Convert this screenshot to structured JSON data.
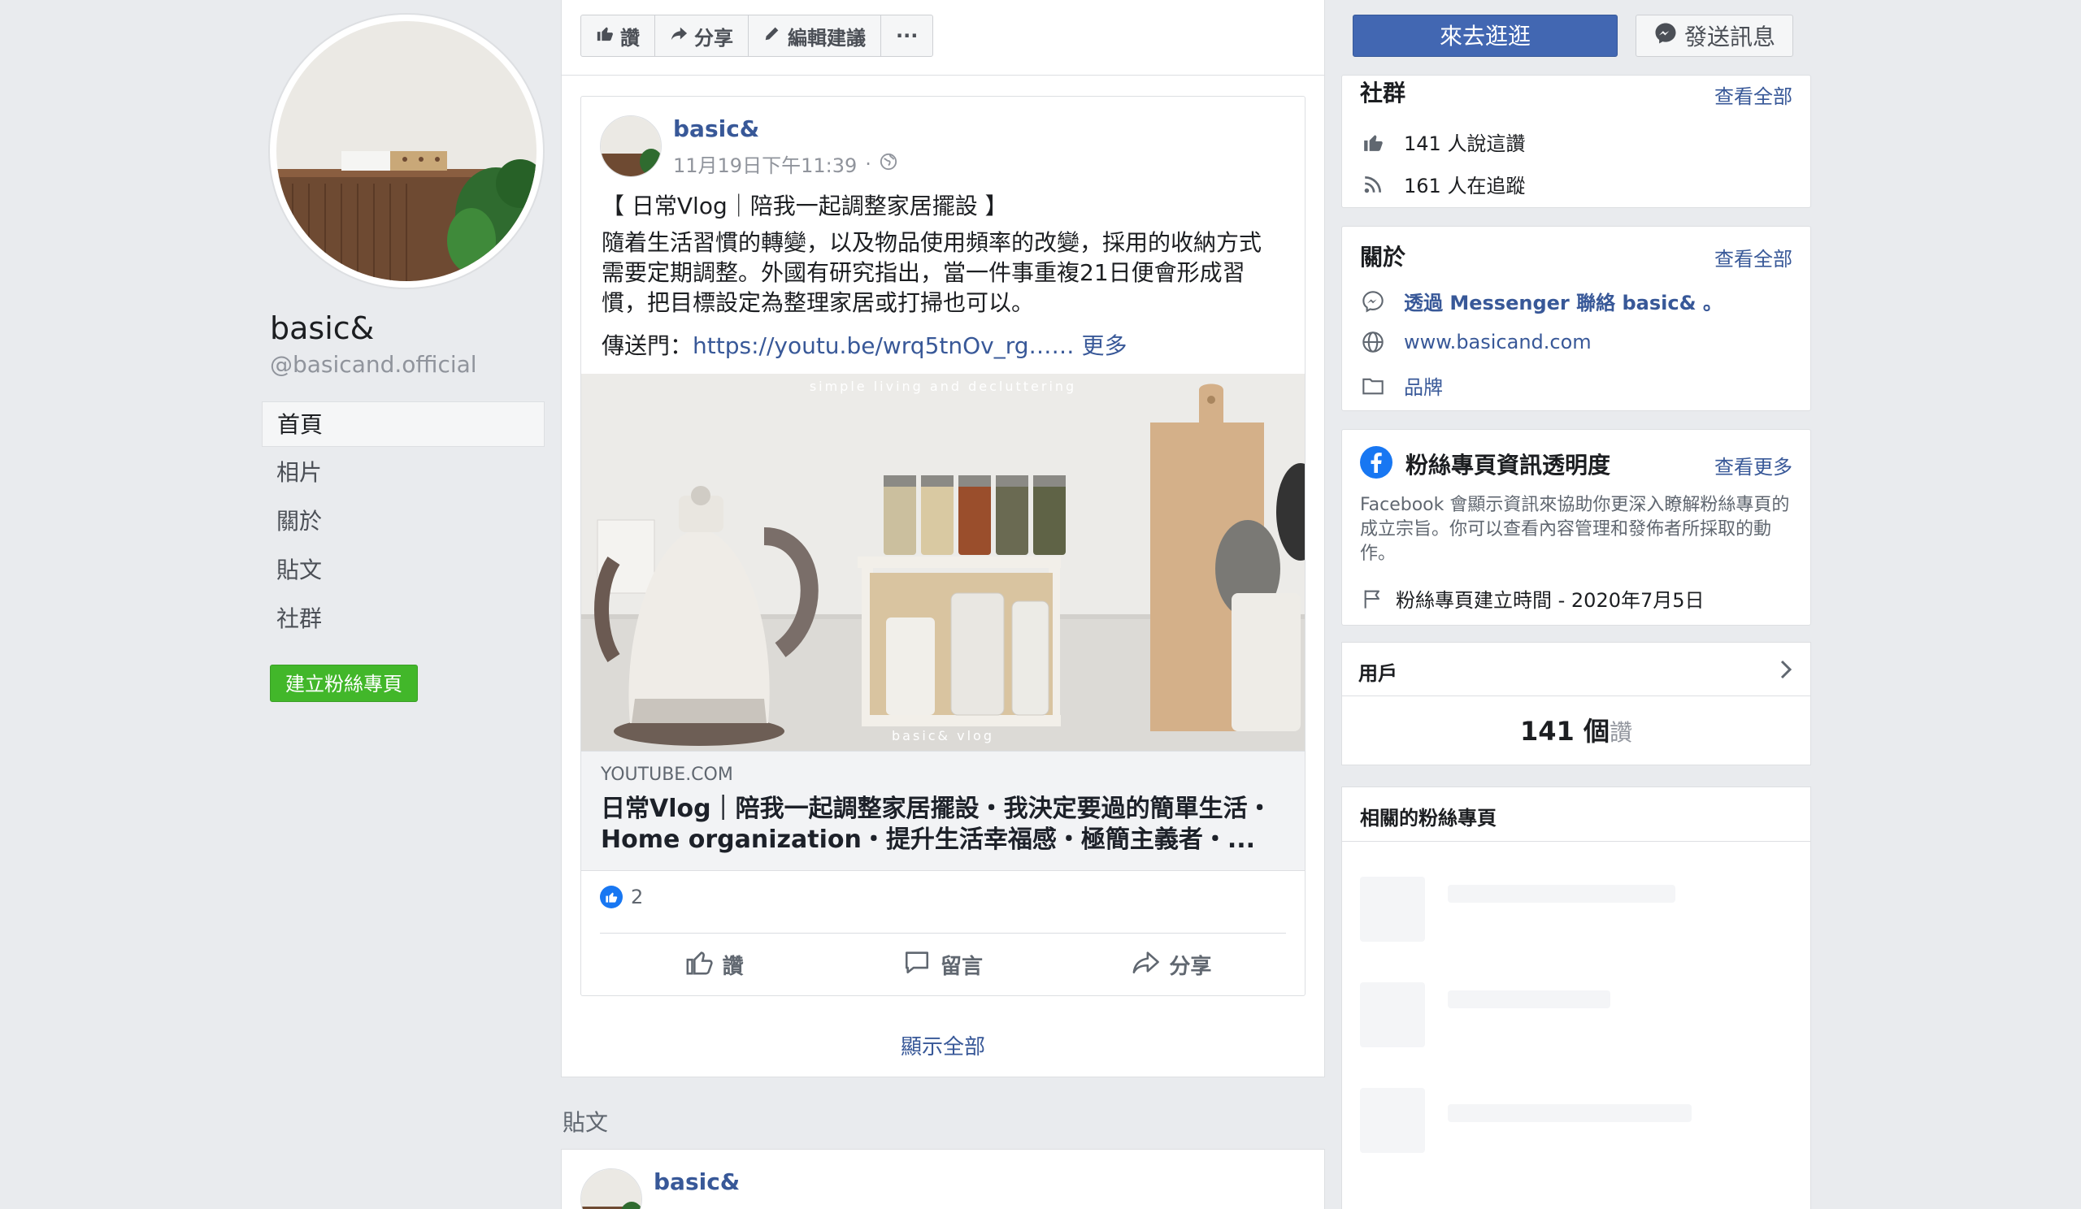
{
  "page": {
    "name": "basic&",
    "handle": "@basicand.official"
  },
  "nav": {
    "items": [
      {
        "label": "首頁",
        "active": true
      },
      {
        "label": "相片",
        "active": false
      },
      {
        "label": "關於",
        "active": false
      },
      {
        "label": "貼文",
        "active": false
      },
      {
        "label": "社群",
        "active": false
      }
    ],
    "create_page_label": "建立粉絲專頁"
  },
  "action_bar": {
    "like": "讚",
    "share": "分享",
    "suggest_edit": "編輯建議",
    "more": "···"
  },
  "header_buttons": {
    "shop": "來去逛逛",
    "message": "發送訊息"
  },
  "post": {
    "author": "basic&",
    "time": "11月19日下午11:39",
    "dot": "·",
    "title": "【 日常Vlog｜陪我一起調整家居擺設 】",
    "body": "隨着生活習慣的轉變，以及物品使用頻率的改變，採用的收納方式需要定期調整。外國有研究指出，當一件事重複21日便會形成習慣，把目標設定為整理家居或打掃也可以。",
    "link_prefix": "傳送門：",
    "link_url": "https://youtu.be/wrq5tnOv_rg",
    "link_ellipsis": "……",
    "more": "更多",
    "image_caption_top": "simple living and decluttering",
    "image_caption_bottom": "basic& vlog",
    "link_domain": "YOUTUBE.COM",
    "link_title": "日常Vlog｜陪我一起調整家居擺設・我決定要過的簡單生活・Home organization・提升生活幸福感・極簡主義者・...",
    "like_count": "2",
    "actions": {
      "like": "讚",
      "comment": "留言",
      "share": "分享"
    }
  },
  "show_all": "顯示全部",
  "posts_heading": "貼文",
  "post2": {
    "author": "basic&"
  },
  "community": {
    "title": "社群",
    "see_all": "查看全部",
    "likes": "141 人說這讚",
    "follows": "161 人在追蹤"
  },
  "about": {
    "title": "關於",
    "see_all": "查看全部",
    "messenger": "透過 Messenger 聯絡 basic& 。",
    "website": "www.basicand.com",
    "category": "品牌"
  },
  "transparency": {
    "title": "粉絲專頁資訊透明度",
    "see_more": "查看更多",
    "description": "Facebook 會顯示資訊來協助你更深入瞭解粉絲專頁的成立宗旨。你可以查看內容管理和發佈者所採取的動作。",
    "created": "粉絲專頁建立時間 - 2020年7月5日"
  },
  "users": {
    "title": "用戶",
    "count": "141 個",
    "unit": "讚"
  },
  "related": {
    "title": "相關的粉絲專頁"
  },
  "colors": {
    "brand_blue": "#4267b2",
    "link_blue": "#385898",
    "green": "#42b72a",
    "background": "#e9ebee"
  }
}
